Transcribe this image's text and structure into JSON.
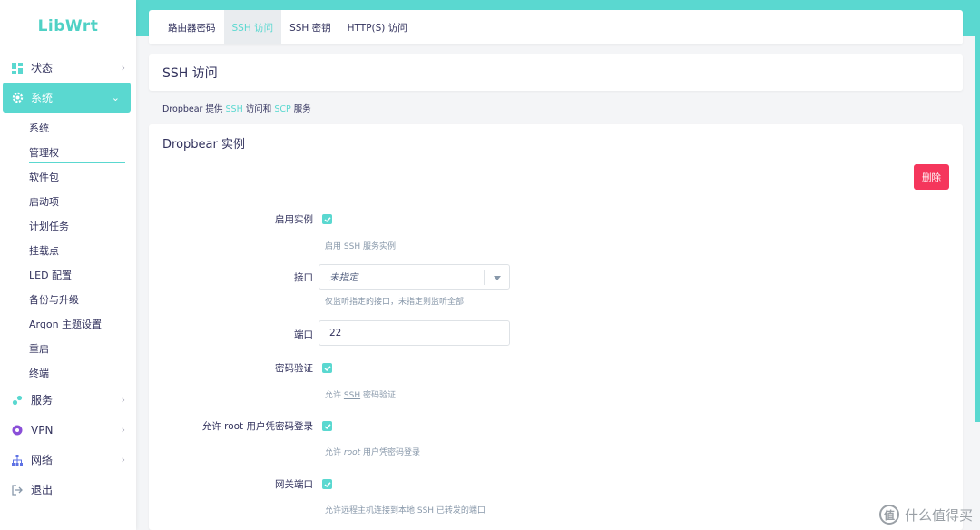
{
  "app": {
    "logo": "LibWrt"
  },
  "sidebar": {
    "top": [
      {
        "label": "状态",
        "icon": "dashboard-icon"
      },
      {
        "label": "系统",
        "icon": "gear-icon",
        "active": true
      }
    ],
    "sub": [
      "系统",
      "管理权",
      "软件包",
      "启动项",
      "计划任务",
      "挂载点",
      "LED 配置",
      "备份与升级",
      "Argon 主题设置",
      "重启",
      "终端"
    ],
    "bottom": [
      {
        "label": "服务",
        "icon": "services-icon"
      },
      {
        "label": "VPN",
        "icon": "vpn-icon"
      },
      {
        "label": "网络",
        "icon": "network-icon"
      },
      {
        "label": "退出",
        "icon": "logout-icon"
      }
    ]
  },
  "tabs": [
    "路由器密码",
    "SSH 访问",
    "SSH 密钥",
    "HTTP(S) 访问"
  ],
  "page": {
    "title": "SSH 访问",
    "desc_pre": "Dropbear 提供",
    "desc_ssh": "SSH",
    "desc_mid": "访问和",
    "desc_scp": "SCP",
    "desc_post": "服务"
  },
  "section": {
    "title": "Dropbear 实例",
    "delete_label": "删除",
    "enable_label": "启用实例",
    "enable_help_pre": "启用",
    "enable_help_ssh": "SSH",
    "enable_help_post": "服务实例",
    "iface_label": "接口",
    "iface_value": "未指定",
    "iface_help": "仅监听指定的接口，未指定则监听全部",
    "port_label": "端口",
    "port_value": "22",
    "pw_label": "密码验证",
    "pw_help_pre": "允许",
    "pw_help_ssh": "SSH",
    "pw_help_post": "密码验证",
    "root_label": "允许 root 用户凭密码登录",
    "root_help_pre": "允许",
    "root_help_root": "root",
    "root_help_post": "用户凭密码登录",
    "gw_label": "网关端口",
    "gw_help": "允许远程主机连接到本地 SSH 已转发的端口"
  },
  "watermark": {
    "glyph": "值",
    "text": "什么值得买"
  },
  "colors": {
    "accent": "#5ad8d0",
    "danger": "#f5365c",
    "text": "#32325d"
  }
}
